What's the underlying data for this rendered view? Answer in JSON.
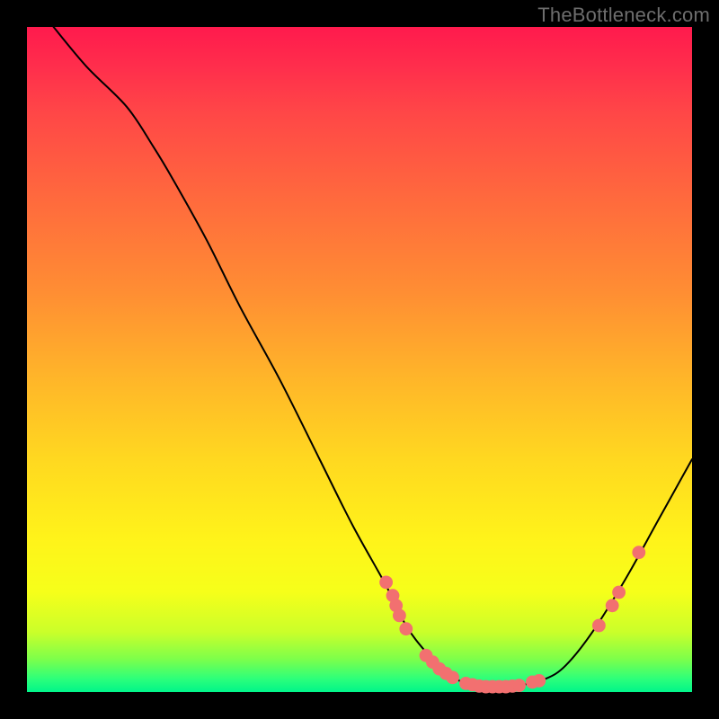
{
  "watermark": "TheBottleneck.com",
  "chart_data": {
    "type": "line",
    "title": "",
    "xlabel": "",
    "ylabel": "",
    "xlim": [
      0,
      100
    ],
    "ylim": [
      0,
      100
    ],
    "grid": false,
    "curve": [
      {
        "x": 4,
        "y": 100
      },
      {
        "x": 9,
        "y": 94
      },
      {
        "x": 15,
        "y": 88
      },
      {
        "x": 19,
        "y": 82
      },
      {
        "x": 22,
        "y": 77
      },
      {
        "x": 27,
        "y": 68
      },
      {
        "x": 32,
        "y": 58
      },
      {
        "x": 38,
        "y": 47
      },
      {
        "x": 44,
        "y": 35
      },
      {
        "x": 49,
        "y": 25
      },
      {
        "x": 54,
        "y": 16
      },
      {
        "x": 57,
        "y": 10
      },
      {
        "x": 60,
        "y": 6
      },
      {
        "x": 63,
        "y": 3
      },
      {
        "x": 66,
        "y": 1.3
      },
      {
        "x": 70,
        "y": 0.8
      },
      {
        "x": 74,
        "y": 1.0
      },
      {
        "x": 78,
        "y": 2.0
      },
      {
        "x": 81,
        "y": 4
      },
      {
        "x": 85,
        "y": 9
      },
      {
        "x": 90,
        "y": 17
      },
      {
        "x": 95,
        "y": 26
      },
      {
        "x": 100,
        "y": 35
      }
    ],
    "markers": [
      {
        "x": 54,
        "y": 16.5
      },
      {
        "x": 55,
        "y": 14.5
      },
      {
        "x": 55.5,
        "y": 13
      },
      {
        "x": 56,
        "y": 11.5
      },
      {
        "x": 57,
        "y": 9.5
      },
      {
        "x": 60,
        "y": 5.5
      },
      {
        "x": 61,
        "y": 4.5
      },
      {
        "x": 62,
        "y": 3.5
      },
      {
        "x": 63,
        "y": 2.8
      },
      {
        "x": 64,
        "y": 2.2
      },
      {
        "x": 66,
        "y": 1.3
      },
      {
        "x": 67,
        "y": 1.1
      },
      {
        "x": 68,
        "y": 0.9
      },
      {
        "x": 69,
        "y": 0.8
      },
      {
        "x": 70,
        "y": 0.8
      },
      {
        "x": 71,
        "y": 0.8
      },
      {
        "x": 72,
        "y": 0.8
      },
      {
        "x": 73,
        "y": 0.9
      },
      {
        "x": 74,
        "y": 1.0
      },
      {
        "x": 76,
        "y": 1.5
      },
      {
        "x": 77,
        "y": 1.7
      },
      {
        "x": 86,
        "y": 10
      },
      {
        "x": 88,
        "y": 13
      },
      {
        "x": 89,
        "y": 15
      },
      {
        "x": 92,
        "y": 21
      }
    ],
    "marker_color": "#f27070",
    "line_color": "#000000"
  }
}
